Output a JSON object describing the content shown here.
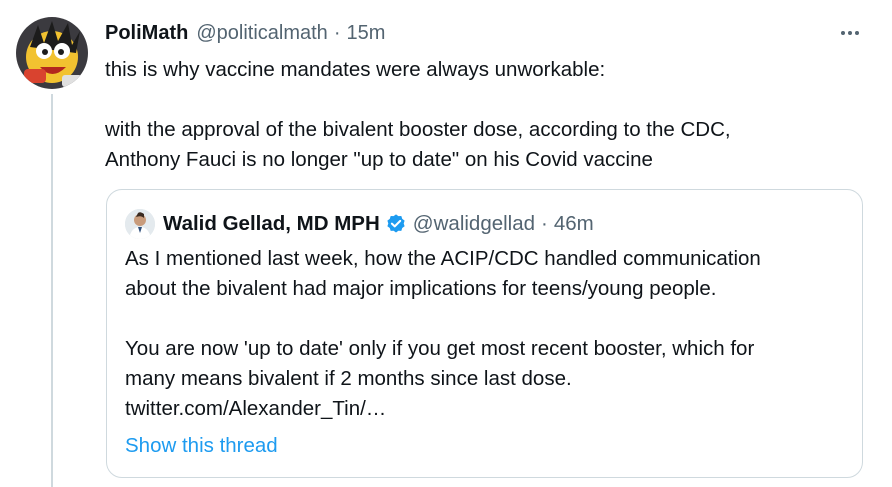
{
  "tweet": {
    "author_name": "PoliMath",
    "author_handle": "@politicalmath",
    "separator": "·",
    "time": "15m",
    "lines": [
      "this is why vaccine mandates were always unworkable:",
      "with the approval of the bivalent booster dose, according to the CDC,",
      "Anthony Fauci is no longer \"up to date\" on his Covid vaccine"
    ]
  },
  "quote": {
    "author_name": "Walid Gellad, MD MPH",
    "author_handle": "@walidgellad",
    "separator": "·",
    "time": "46m",
    "verified": true,
    "lines": [
      "As I mentioned last week, how the ACIP/CDC handled communication",
      "about the bivalent had major implications for teens/young people.",
      "You are now 'up to date' only if you get most recent booster, which for",
      "many means bivalent if 2 months since last dose."
    ],
    "link": "twitter.com/Alexander_Tin/…",
    "show_thread": "Show this thread"
  },
  "colors": {
    "text_primary": "#0f1419",
    "text_secondary": "#536471",
    "accent": "#1d9bf0",
    "border": "#cfd9de"
  },
  "icons": {
    "more": "more-horizontal-icon",
    "verified": "verified-badge-icon"
  }
}
